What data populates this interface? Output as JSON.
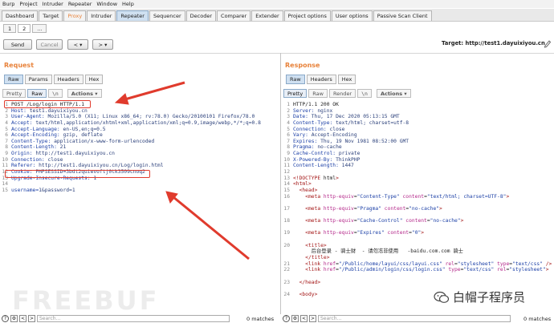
{
  "menu": [
    "Burp",
    "Project",
    "Intruder",
    "Repeater",
    "Window",
    "Help"
  ],
  "main_tabs": [
    "Dashboard",
    "Target",
    "Proxy",
    "Intruder",
    "Repeater",
    "Sequencer",
    "Decoder",
    "Comparer",
    "Extender",
    "Project options",
    "User options",
    "Passive Scan Client"
  ],
  "sub_tabs": [
    "1",
    "2",
    "..."
  ],
  "toolbar": {
    "send": "Send",
    "cancel": "Cancel",
    "prev": "< ▾",
    "next": "> ▾",
    "target": "Target: http://test1.dayuixiyou.cn"
  },
  "request": {
    "title": "Request",
    "tabs": [
      "Raw",
      "Params",
      "Headers",
      "Hex"
    ],
    "view_tabs": [
      "Pretty",
      "Raw",
      "\\n"
    ],
    "actions": "Actions ▾",
    "lines": [
      {
        "n": "1",
        "t": "POST /Log/login HTTP/1.1"
      },
      {
        "n": "2",
        "k": "Host:",
        "v": " test1.dayuixiyou.cn"
      },
      {
        "n": "3",
        "k": "User-Agent:",
        "v": " Mozilla/5.0 (X11; Linux x86_64; rv:78.0) Gecko/20100101 Firefox/78.0"
      },
      {
        "n": "4",
        "k": "Accept:",
        "v": " text/html,application/xhtml+xml,application/xml;q=0.9,image/webp,*/*;q=0.8"
      },
      {
        "n": "5",
        "k": "Accept-Language:",
        "v": " en-US,en;q=0.5"
      },
      {
        "n": "6",
        "k": "Accept-Encoding:",
        "v": " gzip, deflate"
      },
      {
        "n": "7",
        "k": "Content-Type:",
        "v": " application/x-www-form-urlencoded"
      },
      {
        "n": "8",
        "k": "Content-Length:",
        "v": " 21"
      },
      {
        "n": "9",
        "k": "Origin:",
        "v": " http://test1.dayuixiyou.cn"
      },
      {
        "n": "10",
        "k": "Connection:",
        "v": " close"
      },
      {
        "n": "11",
        "k": "Referer:",
        "v": " http://test1.dayuixiyou.cn/Log/login.html"
      },
      {
        "n": "12",
        "k": "Cookie:",
        "v": " PHPSESSID=3bdt2quievoftj0tk3509cnoq2"
      },
      {
        "n": "13",
        "k": "Upgrade-Insecure-Requests:",
        "v": " 1"
      },
      {
        "n": "14",
        "t": ""
      },
      {
        "n": "15",
        "k": "username=",
        "v": "1&password=1"
      }
    ]
  },
  "response": {
    "title": "Response",
    "tabs": [
      "Raw",
      "Headers",
      "Hex"
    ],
    "view_tabs": [
      "Pretty",
      "Raw",
      "Render",
      "\\n"
    ],
    "actions": "Actions ▾",
    "lines": [
      {
        "n": "1",
        "t": "HTTP/1.1 200 OK"
      },
      {
        "n": "2",
        "k": "Server:",
        "v": " nginx"
      },
      {
        "n": "3",
        "k": "Date:",
        "v": " Thu, 17 Dec 2020 05:13:15 GMT"
      },
      {
        "n": "4",
        "k": "Content-Type:",
        "v": " text/html; charset=utf-8"
      },
      {
        "n": "5",
        "k": "Connection:",
        "v": " close"
      },
      {
        "n": "6",
        "k": "Vary:",
        "v": " Accept-Encoding"
      },
      {
        "n": "7",
        "k": "Expires:",
        "v": " Thu, 19 Nov 1981 08:52:00 GMT"
      },
      {
        "n": "8",
        "k": "Pragma:",
        "v": " no-cache"
      },
      {
        "n": "9",
        "k": "Cache-Control:",
        "v": " private"
      },
      {
        "n": "10",
        "k": "X-Powered-By:",
        "v": " ThinkPHP"
      },
      {
        "n": "11",
        "k": "Content-Length:",
        "v": " 1447"
      },
      {
        "n": "12",
        "t": ""
      },
      {
        "n": "13",
        "h": "<!DOCTYPE html>"
      },
      {
        "n": "14",
        "h": "<html>"
      },
      {
        "n": "15",
        "h": "  <head>"
      },
      {
        "n": "16",
        "h": "    <meta http-equiv=\"Content-Type\" content=\"text/html; charset=UTF-8\">"
      },
      {
        "n": "",
        "t": ""
      },
      {
        "n": "17",
        "h": "    <meta http-equiv=\"Pragma\" content=\"no-cache\">"
      },
      {
        "n": "",
        "t": ""
      },
      {
        "n": "18",
        "h": "    <meta http-equiv=\"Cache-Control\" content=\"no-cache\">"
      },
      {
        "n": "",
        "t": ""
      },
      {
        "n": "19",
        "h": "    <meta http-equiv=\"Expires\" content=\"0\">"
      },
      {
        "n": "",
        "t": ""
      },
      {
        "n": "20",
        "h": "    <title>"
      },
      {
        "n": "",
        "t": "      后台登录 - 骑士财  - 请勿冻非使用   -baidu.com.com 骑士"
      },
      {
        "n": "",
        "h": "    </title>"
      },
      {
        "n": "21",
        "h": "    <link href=\"/Public/home/layui/css/layui.css\" rel=\"stylesheet\" type=\"text/css\" />"
      },
      {
        "n": "22",
        "h": "    <link href=\"/Public/admin/login/css/login.css\" type=\"text/css\" rel=\"stylesheet\">"
      },
      {
        "n": "",
        "t": ""
      },
      {
        "n": "23",
        "h": "  </head>"
      },
      {
        "n": "",
        "t": ""
      },
      {
        "n": "24",
        "h": "  <body>"
      }
    ]
  },
  "footer": {
    "search_placeholder": "Search...",
    "matches_left": "0 matches",
    "matches_right": "0 matches"
  },
  "watermark": "FREEBUF",
  "wechat_account": "白帽子程序员",
  "colors": {
    "accent": "#e8823a",
    "annotation_red": "#e03b2d"
  }
}
